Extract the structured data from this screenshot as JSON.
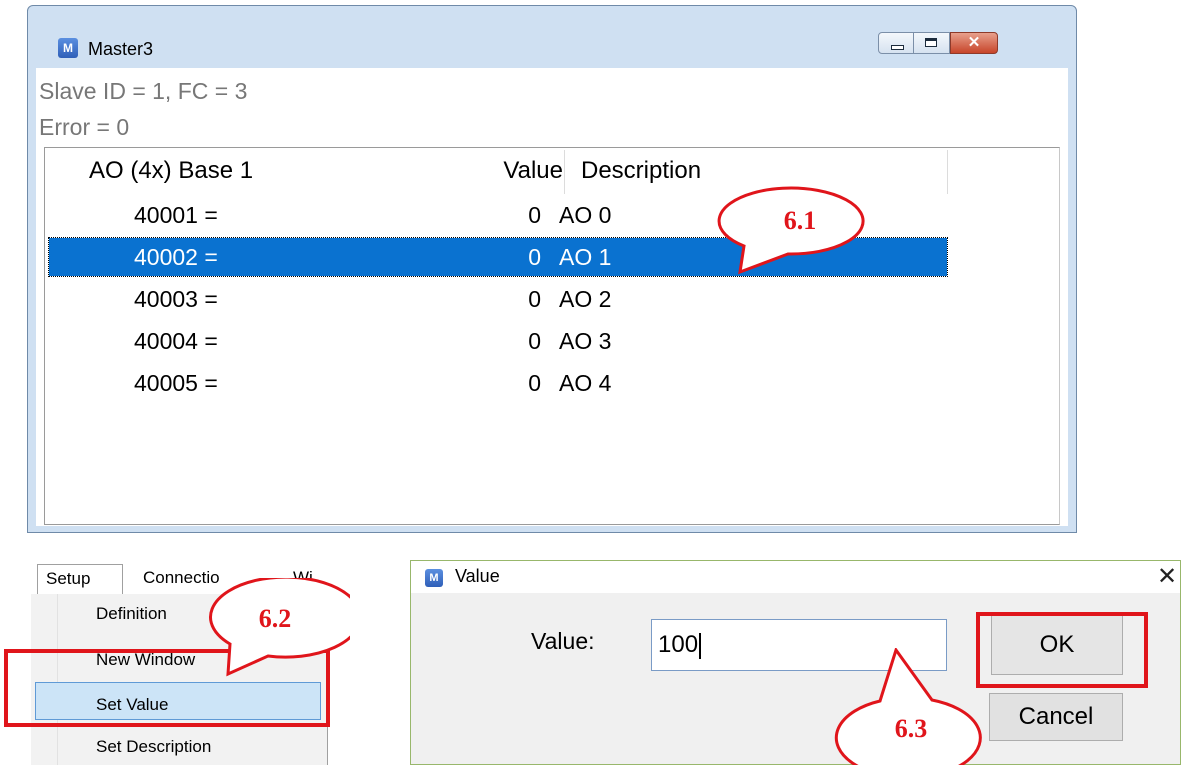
{
  "master_window": {
    "title": "Master3",
    "status_line1": "Slave ID = 1, FC = 3",
    "status_line2": "Error = 0",
    "columns": [
      "AO (4x) Base 1",
      "Value",
      "Description"
    ],
    "rows": [
      {
        "address": "40001 =",
        "value": "0",
        "description": "AO 0",
        "selected": false
      },
      {
        "address": "40002 =",
        "value": "0",
        "description": "AO 1",
        "selected": true
      },
      {
        "address": "40003 =",
        "value": "0",
        "description": "AO 2",
        "selected": false
      },
      {
        "address": "40004 =",
        "value": "0",
        "description": "AO 3",
        "selected": false
      },
      {
        "address": "40005 =",
        "value": "0",
        "description": "AO 4",
        "selected": false
      }
    ]
  },
  "menu": {
    "tabs": [
      "Setup",
      "Connectio",
      "Wi"
    ],
    "items": [
      "Definition",
      "New Window",
      "Set Value",
      "Set Description"
    ],
    "highlighted": "Set Value"
  },
  "dialog": {
    "title": "Value",
    "close_glyph": "✕",
    "label": "Value:",
    "input_value": "100",
    "ok_label": "OK",
    "cancel_label": "Cancel"
  },
  "callouts": [
    "6.1",
    "6.2",
    "6.3"
  ],
  "colors": {
    "selection": "#0a72d0",
    "annotation_red": "#e0151b",
    "menu_highlight": "#cce4f7"
  }
}
